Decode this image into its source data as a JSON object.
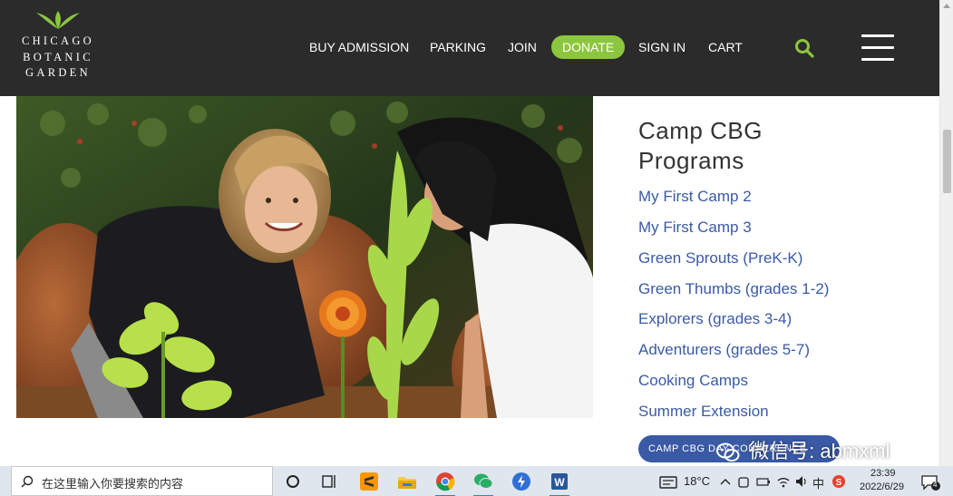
{
  "logo": {
    "lines": [
      "CHICAGO",
      "BOTANIC",
      "GARDEN"
    ]
  },
  "nav": {
    "items": [
      {
        "label": "BUY ADMISSION"
      },
      {
        "label": "PARKING"
      },
      {
        "label": "JOIN"
      },
      {
        "label": "DONATE"
      },
      {
        "label": "SIGN IN"
      },
      {
        "label": "CART"
      }
    ],
    "search_icon": "search-icon",
    "menu_icon": "hamburger-menu-icon"
  },
  "sidebar": {
    "title_line1": "Camp CBG",
    "title_line2": "Programs",
    "links": [
      {
        "label": "My First Camp 2"
      },
      {
        "label": "My First Camp 3"
      },
      {
        "label": "Green Sprouts (PreK-K)"
      },
      {
        "label": "Green Thumbs (grades 1-2)"
      },
      {
        "label": "Explorers (grades 3-4)"
      },
      {
        "label": "Adventurers (grades 5-7)"
      },
      {
        "label": "Cooking Camps"
      },
      {
        "label": "Summer Extension"
      }
    ],
    "cta_label": "CAMP CBG DAY CONFERENCE"
  },
  "watermark": {
    "text": "微信号: abmxml"
  },
  "taskbar": {
    "search_placeholder": "在这里输入你要搜索的内容",
    "apps": [
      "task-view-icon",
      "sublime-icon",
      "file-explorer-icon",
      "chrome-icon",
      "wechat-icon",
      "feishu-icon",
      "word-icon"
    ],
    "temperature": "18°C",
    "ime": "中",
    "time": "23:39",
    "date": "2022/6/29",
    "notification_count": "4"
  },
  "colors": {
    "header_bg": "#2b2b2b",
    "donate_green": "#8cc63f",
    "link_blue": "#3a5aa6",
    "title_gray": "#333333"
  }
}
